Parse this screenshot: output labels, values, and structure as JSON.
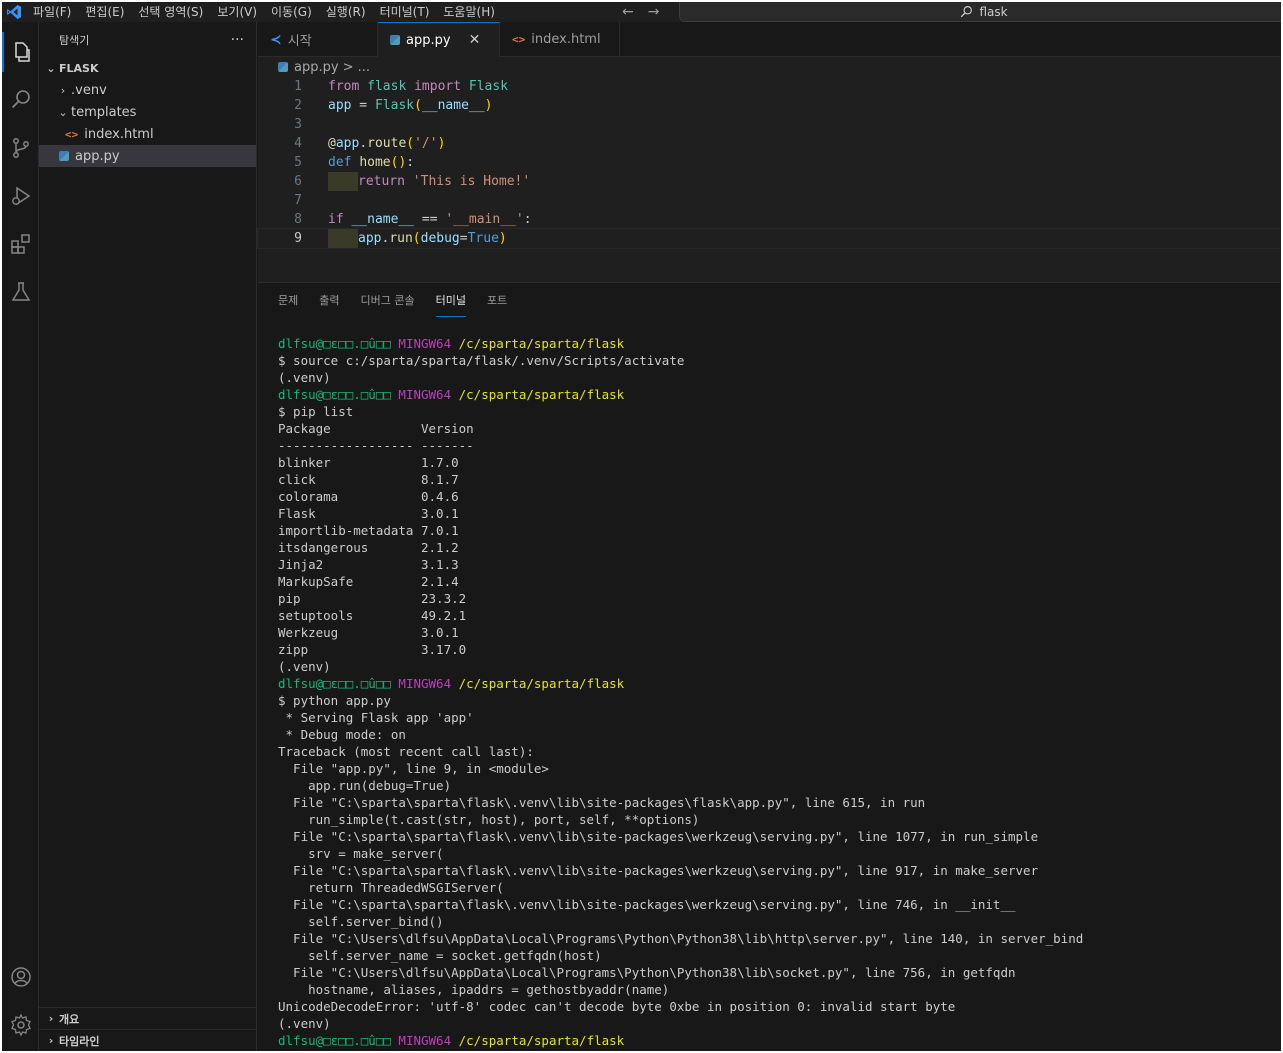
{
  "menu": [
    "파일(F)",
    "편집(E)",
    "선택 영역(S)",
    "보기(V)",
    "이동(G)",
    "실행(R)",
    "터미널(T)",
    "도움말(H)"
  ],
  "search": {
    "text": "flask"
  },
  "explorer": {
    "title": "탐색기",
    "more": "···",
    "folder": "FLASK",
    "items": [
      {
        "label": ".venv",
        "indent": 1,
        "kind": "folder-collapsed"
      },
      {
        "label": "templates",
        "indent": 1,
        "kind": "folder-open"
      },
      {
        "label": "index.html",
        "indent": 2,
        "kind": "html"
      },
      {
        "label": "app.py",
        "indent": 1,
        "kind": "python",
        "selected": true
      }
    ],
    "outline": "개요",
    "timeline": "타임라인"
  },
  "tabs": [
    {
      "label": "시작",
      "icon": "vscode-icon"
    },
    {
      "label": "app.py",
      "icon": "python-icon",
      "active": true,
      "close": "✕"
    },
    {
      "label": "index.html",
      "icon": "html-icon"
    }
  ],
  "breadcrumb": {
    "file": "app.py",
    "rest": "> ..."
  },
  "code": {
    "line_numbers": [
      "1",
      "2",
      "3",
      "4",
      "5",
      "6",
      "7",
      "8",
      "9"
    ],
    "current_line": 9
  },
  "panel": {
    "tabs": [
      "문제",
      "출력",
      "디버그 콘솔",
      "터미널",
      "포트"
    ],
    "active_tab": "터미널"
  },
  "terminal": {
    "prompt_user": "dlfsu@□ε□□.□û□□",
    "prompt_env": "MINGW64",
    "prompt_path": "/c/sparta/sparta/flask",
    "lines": [
      "$ source c:/sparta/sparta/flask/.venv/Scripts/activate",
      "(.venv)",
      "$ pip list",
      "Package            Version",
      "------------------ -------",
      "blinker            1.7.0",
      "click              8.1.7",
      "colorama           0.4.6",
      "Flask              3.0.1",
      "importlib-metadata 7.0.1",
      "itsdangerous       2.1.2",
      "Jinja2             3.1.3",
      "MarkupSafe         2.1.4",
      "pip                23.3.2",
      "setuptools         49.2.1",
      "Werkzeug           3.0.1",
      "zipp               3.17.0",
      "(.venv)",
      "$ python app.py",
      " * Serving Flask app 'app'",
      " * Debug mode: on",
      "Traceback (most recent call last):",
      "  File \"app.py\", line 9, in <module>",
      "    app.run(debug=True)",
      "  File \"C:\\sparta\\sparta\\flask\\.venv\\lib\\site-packages\\flask\\app.py\", line 615, in run",
      "    run_simple(t.cast(str, host), port, self, **options)",
      "  File \"C:\\sparta\\sparta\\flask\\.venv\\lib\\site-packages\\werkzeug\\serving.py\", line 1077, in run_simple",
      "    srv = make_server(",
      "  File \"C:\\sparta\\sparta\\flask\\.venv\\lib\\site-packages\\werkzeug\\serving.py\", line 917, in make_server",
      "    return ThreadedWSGIServer(",
      "  File \"C:\\sparta\\sparta\\flask\\.venv\\lib\\site-packages\\werkzeug\\serving.py\", line 746, in __init__",
      "    self.server_bind()",
      "  File \"C:\\Users\\dlfsu\\AppData\\Local\\Programs\\Python\\Python38\\lib\\http\\server.py\", line 140, in server_bind",
      "    self.server_name = socket.getfqdn(host)",
      "  File \"C:\\Users\\dlfsu\\AppData\\Local\\Programs\\Python\\Python38\\lib\\socket.py\", line 756, in getfqdn",
      "    hostname, aliases, ipaddrs = gethostbyaddr(name)",
      "UnicodeDecodeError: 'utf-8' codec can't decode byte 0xbe in position 0: invalid start byte",
      "(.venv)"
    ]
  }
}
